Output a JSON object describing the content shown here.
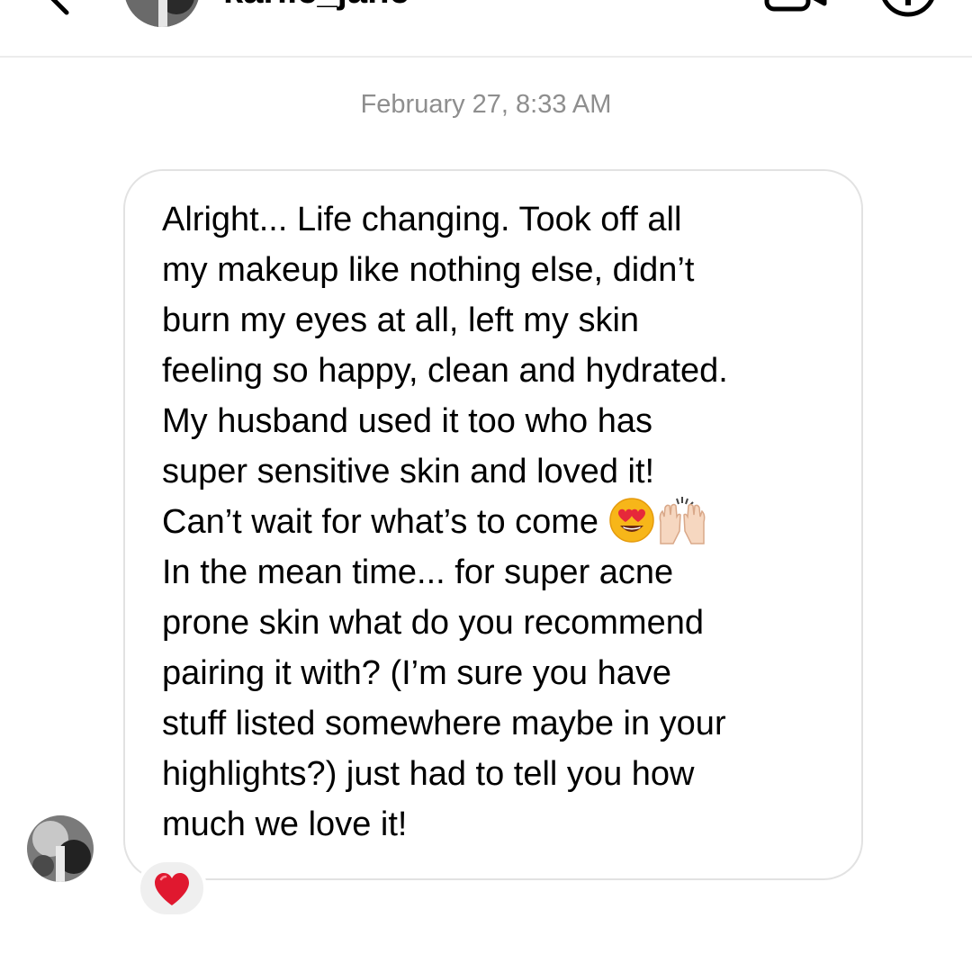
{
  "header": {
    "username": "karlie_jane",
    "back_icon": "chevron-left-icon",
    "video_icon": "video-camera-icon",
    "info_icon": "info-icon"
  },
  "timestamp": "February 27, 8:33 AM",
  "message": {
    "lines": [
      "Alright... Life changing. Took off all",
      "my makeup like nothing else, didn’t",
      "burn my eyes at all, left my skin",
      "feeling so happy, clean and hydrated.",
      "My husband used it too who has",
      "super sensitive skin and loved it!",
      "Can’t wait for what’s to come",
      "In the mean time... for super acne",
      "prone skin what do you recommend",
      "pairing it with? (I’m sure you have",
      "stuff listed somewhere maybe in your",
      "highlights?) just had to tell you how",
      "much we love it!"
    ],
    "emojis": [
      "heart-eyes-emoji",
      "raising-hands-emoji"
    ]
  },
  "reaction": {
    "icon": "red-heart-icon"
  },
  "colors": {
    "timestamp": "#8e8e8e",
    "bubble_border": "#e2e2e2",
    "reaction_bg": "#efefef",
    "heart": "#e0182f"
  }
}
